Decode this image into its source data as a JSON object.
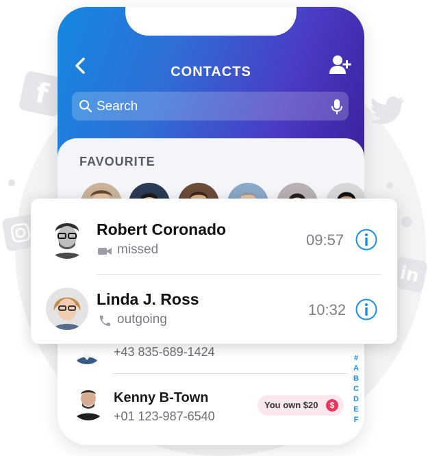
{
  "header": {
    "title": "CONTACTS",
    "back_icon": "chevron-left-icon",
    "add_icon": "add-contact-icon"
  },
  "search": {
    "placeholder": "Search",
    "icon": "search-icon",
    "mic_icon": "microphone-icon"
  },
  "favourites": {
    "label": "FAVOURITE",
    "count_visible": 6
  },
  "recent_calls": [
    {
      "name": "Robert Coronado",
      "type": "missed",
      "type_icon": "video-icon",
      "time": "09:57"
    },
    {
      "name": "Linda J. Ross",
      "type": "outgoing",
      "type_icon": "phone-icon",
      "time": "10:32"
    }
  ],
  "contacts": [
    {
      "phone": "+43 835-689-1424"
    },
    {
      "name": "Kenny B-Town",
      "phone": "+01 123-987-6540",
      "badge": "You own $20",
      "badge_icon": "dollar-icon"
    }
  ],
  "alphabet_index": [
    "#",
    "A",
    "B",
    "C",
    "D",
    "E",
    "F"
  ],
  "colors": {
    "accent": "#1a8ee6",
    "header_start": "#1488e0",
    "header_end": "#3b1e9a",
    "badge_bg": "#fbe8ec",
    "badge_icon": "#e8375a"
  }
}
